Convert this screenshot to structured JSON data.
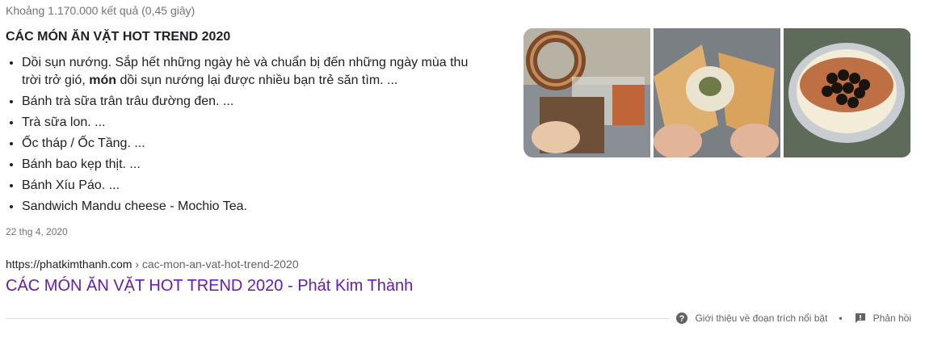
{
  "result_stats": "Khoảng 1.170.000 kết quả (0,45 giây)",
  "snippet": {
    "title": "CÁC MÓN ĂN VẶT HOT TREND 2020",
    "items": [
      {
        "before": "Dồi sụn nướng. Sắp hết những ngày hè và chuẩn bị đến những ngày mùa thu trời trở gió, ",
        "bold": "món",
        "after": " dồi sụn nướng lại được nhiều bạn trẻ săn tìm. ..."
      },
      {
        "text": "Bánh trà sữa trân trâu đường đen. ..."
      },
      {
        "text": "Trà sữa lon. ..."
      },
      {
        "text": "Ốc tháp / Ốc Tầng. ..."
      },
      {
        "text": "Bánh bao kẹp thịt. ..."
      },
      {
        "text": "Bánh Xíu Páo. ..."
      },
      {
        "text": "Sandwich Mandu cheese - Mochio Tea."
      }
    ],
    "date": "22 thg 4, 2020"
  },
  "result": {
    "domain": "https://phatkimthanh.com",
    "path": " › cac-mon-an-vat-hot-trend-2020",
    "title": "CÁC MÓN ĂN VẶT HOT TREND 2020 - Phát Kim Thành"
  },
  "footer": {
    "about_label": "Giới thiệu về đoạn trích nổi bật",
    "separator": "•",
    "feedback_label": "Phản hồi"
  },
  "colors": {
    "link_visited": "#681da8",
    "muted": "#70757a",
    "text": "#202124"
  },
  "icons": {
    "about": "help-circle-icon",
    "feedback": "feedback-icon"
  }
}
